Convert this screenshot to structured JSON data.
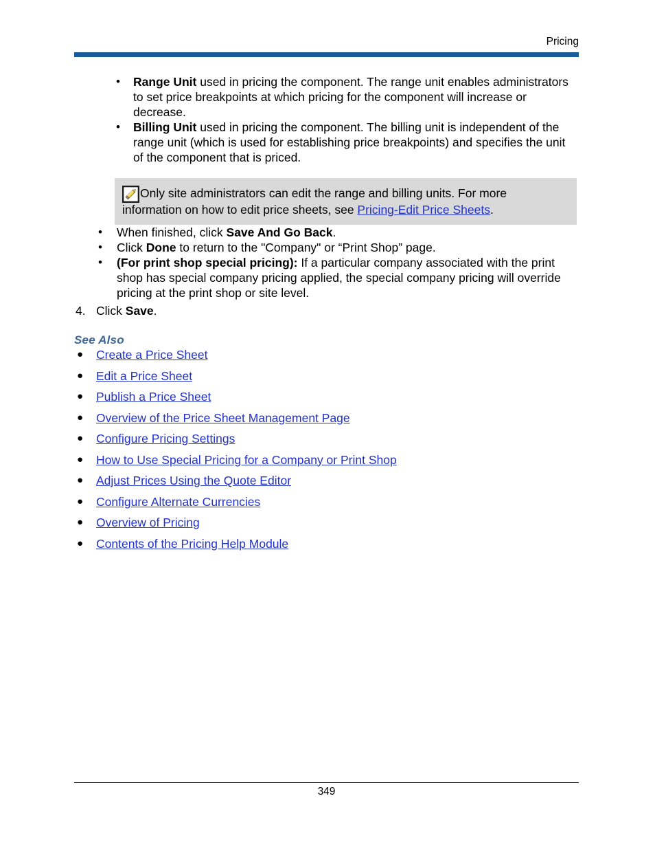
{
  "header": {
    "title": "Pricing",
    "rule_color": "#1a5b9c"
  },
  "bullet_glyph": "•",
  "round_bullet_glyph": "●",
  "unit_bullets": [
    {
      "bold_lead": "Range Unit",
      "text": " used in pricing the component. The range unit enables administrators to set price breakpoints at which pricing for the component will increase or decrease."
    },
    {
      "bold_lead": "Billing Unit",
      "text": " used in pricing the component. The billing unit is independent of the range unit (which is used for establishing price breakpoints) and specifies the unit of the component that is priced."
    }
  ],
  "note": {
    "icon": "pencil-note-icon",
    "text_before_link": "Only site administrators can edit the range and billing units. For more information on how to edit price sheets, see ",
    "link_text": "Pricing-Edit Price Sheets",
    "text_after_link": ".",
    "background": "#d9d9d9"
  },
  "step_bullets": [
    {
      "pre": "When finished, click ",
      "bold": "Save And Go Back",
      "post": "."
    },
    {
      "pre": "Click ",
      "bold": "Done",
      "post": " to return to the \"Company\" or “Print Shop” page."
    },
    {
      "pre": "",
      "bold": " (For print shop special pricing):",
      "post": " If a particular company associated with the print shop has special company pricing applied, the special company pricing will override pricing at the print shop or site level."
    }
  ],
  "numbered_step": {
    "number": "4.",
    "pre": "Click ",
    "bold": "Save",
    "post": "."
  },
  "see_also": {
    "heading": "See Also",
    "color": "#3c6598",
    "links": [
      "Create a Price Sheet",
      "Edit a Price Sheet",
      "Publish a Price Sheet",
      "Overview of the Price Sheet Management Page",
      "Configure Pricing Settings",
      "How to Use Special Pricing for a Company or Print Shop",
      "Adjust Prices Using the Quote Editor",
      "Configure Alternate Currencies",
      "Overview of Pricing",
      "Contents of the Pricing Help Module"
    ],
    "link_color": "#2232c8"
  },
  "footer": {
    "page_number": "349"
  }
}
